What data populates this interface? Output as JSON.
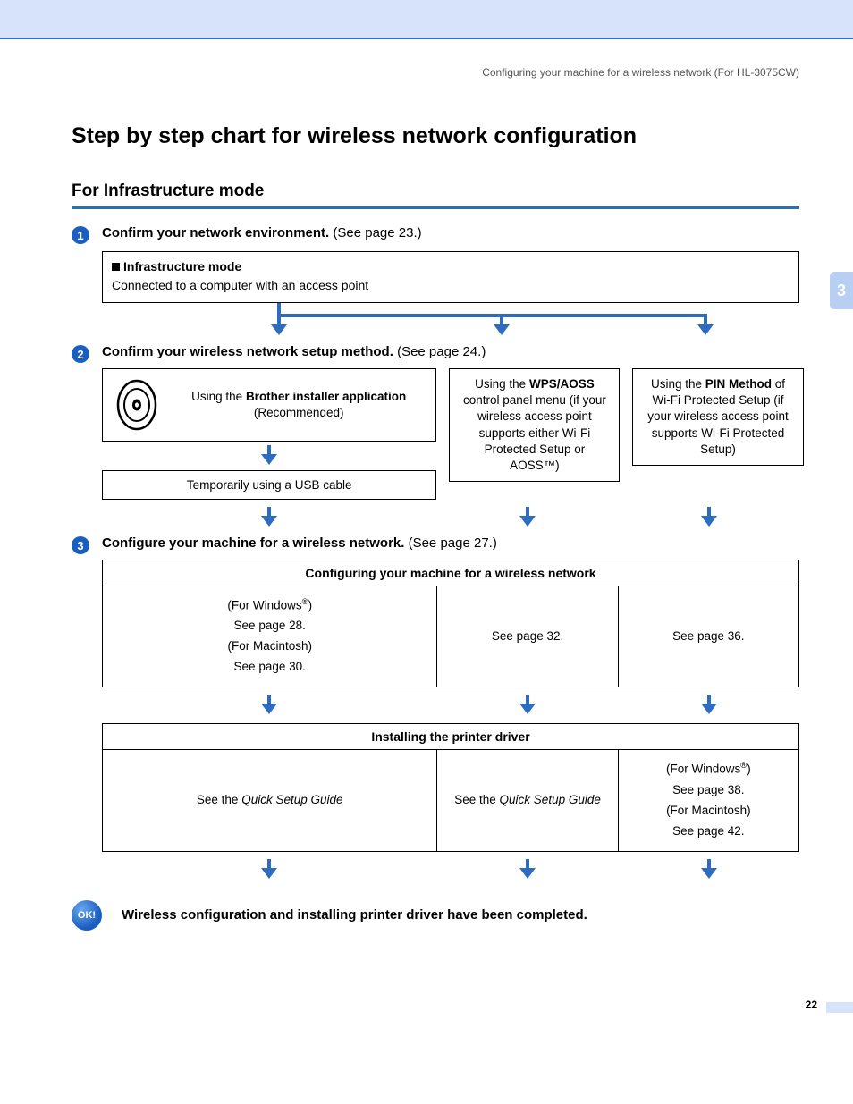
{
  "breadcrumb": "Configuring your machine for a wireless network (For HL-3075CW)",
  "side_tab": "3",
  "page_number": "22",
  "h1": "Step by step chart for wireless network configuration",
  "h2": "For Infrastructure mode",
  "step1": {
    "num": "1",
    "bold": "Confirm your network environment.",
    "rest": " (See page 23.)",
    "box_title": "Infrastructure mode",
    "box_desc": "Connected to a computer with an access point"
  },
  "step2": {
    "num": "2",
    "bold": "Confirm your wireless network setup method.",
    "rest": " (See page 24.)",
    "colA_line1_pre": "Using the ",
    "colA_line1_bold": "Brother installer application",
    "colA_line2": "(Recommended)",
    "colA_usb": "Temporarily using a USB cable",
    "colB_pre": "Using the ",
    "colB_bold": "WPS/AOSS",
    "colB_rest": " control panel menu (if your wireless access point supports either Wi-Fi Protected Setup or AOSS™)",
    "colC_pre": "Using the ",
    "colC_bold": "PIN Method",
    "colC_rest": " of Wi-Fi Protected Setup (if your wireless access point supports Wi-Fi Protected Setup)"
  },
  "step3": {
    "num": "3",
    "bold": "Configure your machine for a wireless network.",
    "rest": " (See page 27.)",
    "table1_header": "Configuring your machine for a wireless network",
    "t1c1_l1": "(For Windows",
    "t1c1_l1b": ")",
    "t1c1_l2": "See page 28.",
    "t1c1_l3": "(For Macintosh)",
    "t1c1_l4": "See page 30.",
    "t1c2": "See page 32.",
    "t1c3": "See page 36.",
    "table2_header": "Installing the printer driver",
    "t2c1_pre": "See the ",
    "t2c1_it": "Quick Setup Guide",
    "t2c2_pre": "See the ",
    "t2c2_it": "Quick Setup Guide",
    "t2c3_l1": "(For Windows",
    "t2c3_l1b": ")",
    "t2c3_l2": "See page 38.",
    "t2c3_l3": "(For Macintosh)",
    "t2c3_l4": "See page 42."
  },
  "ok": {
    "badge": "OK!",
    "text": "Wireless configuration and installing printer driver have been completed."
  }
}
